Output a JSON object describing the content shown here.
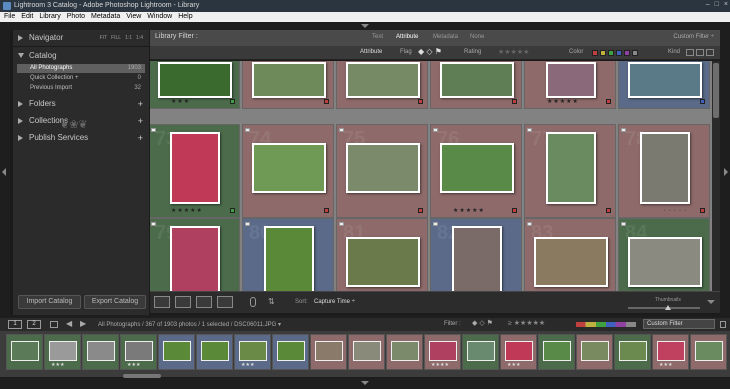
{
  "window": {
    "title": "Lightroom 3 Catalog - Adobe Photoshop Lightroom - Library",
    "controls": [
      "–",
      "□",
      "×"
    ]
  },
  "menu": [
    "File",
    "Edit",
    "Library",
    "Photo",
    "Metadata",
    "View",
    "Window",
    "Help"
  ],
  "left_panel": {
    "navigator": {
      "label": "Navigator",
      "options": [
        "FIT",
        "FILL",
        "1:1",
        "1:4"
      ]
    },
    "catalog": {
      "label": "Catalog",
      "items": [
        {
          "label": "All Photographs",
          "count": "1903"
        },
        {
          "label": "Quick Collection +",
          "count": "0"
        },
        {
          "label": "Previous Import",
          "count": "32"
        }
      ]
    },
    "folders": {
      "label": "Folders"
    },
    "collections": {
      "label": "Collections"
    },
    "publish": {
      "label": "Publish Services"
    },
    "ornament": "❦❀❦",
    "import_label": "Import Catalog",
    "export_label": "Export Catalog"
  },
  "filter_bar": {
    "title": "Library Filter :",
    "tabs": [
      "Text",
      "Attribute",
      "Metadata",
      "None"
    ],
    "selected_tab": "Attribute",
    "custom_filter": "Custom Filter ÷",
    "attr_label": "Attribute",
    "flag_label": "Flag",
    "rating_label": "Rating",
    "color_label": "Color",
    "kind_label": "Kind",
    "stars": "★★★★★",
    "swatch_colors": [
      "#c04040",
      "#c0b040",
      "#40a040",
      "#4060c0",
      "#9040a0",
      "#888888"
    ]
  },
  "grid": {
    "cells": [
      {
        "row": 0,
        "col": 0,
        "bg": "#4b6b4b",
        "photo": "#3a6a2e",
        "stars": "★★★",
        "badge": "#40a040"
      },
      {
        "row": 0,
        "col": 1,
        "bg": "#8e6a6a",
        "photo": "#6f8a5a",
        "badge": "#c04040"
      },
      {
        "row": 0,
        "col": 2,
        "bg": "#8e6a6a",
        "photo": "#768a66",
        "badge": "#c04040"
      },
      {
        "row": 0,
        "col": 3,
        "bg": "#8e6a6a",
        "photo": "#5f7e55",
        "badge": "#c04040"
      },
      {
        "row": 0,
        "col": 4,
        "bg": "#8e6a6a",
        "photo": "#8a6a7a",
        "stars": "★★★★★",
        "badge": "#c04040"
      },
      {
        "row": 0,
        "col": 5,
        "bg": "#5a6a88",
        "photo": "#5a7a88",
        "badge": "#4060c0"
      },
      {
        "row": 1,
        "col": 0,
        "bg": "#4b6b4b",
        "num": "73",
        "photo": "#c03a58",
        "stars": "★★★★★",
        "badge": "#40a040"
      },
      {
        "row": 1,
        "col": 1,
        "bg": "#8e6a6a",
        "num": "74",
        "photo": "#6f9a55",
        "badge": "#c04040"
      },
      {
        "row": 1,
        "col": 2,
        "bg": "#8e6a6a",
        "num": "75",
        "photo": "#7a8a6a",
        "badge": "#c04040"
      },
      {
        "row": 1,
        "col": 3,
        "bg": "#8e6a6a",
        "num": "76",
        "photo": "#5a8a48",
        "stars": "★★★★★",
        "badge": "#c04040"
      },
      {
        "row": 1,
        "col": 4,
        "bg": "#8e6a6a",
        "num": "77",
        "photo": "#6a8a60",
        "badge": "#c04040"
      },
      {
        "row": 1,
        "col": 5,
        "bg": "#8e6a6a",
        "num": "78",
        "photo": "#7a7a70",
        "dots": "• • • • •",
        "badge": "#c04040"
      },
      {
        "row": 2,
        "col": 0,
        "bg": "#4b6b4b",
        "num": "79",
        "photo": "#b04060"
      },
      {
        "row": 2,
        "col": 1,
        "bg": "#5a6a88",
        "num": "80",
        "photo": "#5a8a38"
      },
      {
        "row": 2,
        "col": 2,
        "bg": "#8e6a6a",
        "num": "81",
        "photo": "#6a7a4a"
      },
      {
        "row": 2,
        "col": 3,
        "bg": "#5a6a88",
        "num": "82",
        "photo": "#7a6a68"
      },
      {
        "row": 2,
        "col": 4,
        "bg": "#8e6a6a",
        "num": "83",
        "photo": "#8a7a60"
      },
      {
        "row": 2,
        "col": 5,
        "bg": "#4b6b4b",
        "num": "84",
        "photo": "#8a8a80"
      }
    ]
  },
  "toolbar": {
    "sort_label": "Sort:",
    "sort_value": "Capture Time ÷",
    "thumbnails_label": "Thumbnails"
  },
  "filmstrip_bar": {
    "screens": [
      "1",
      "2"
    ],
    "path": "All Photographs / 367 of 1903 photos / 1 selected / DSC06011.JPG ▾",
    "filter_label": "Filter :",
    "custom_filter": "Custom Filter"
  },
  "filmstrip": [
    {
      "bg": "#4b6b4b",
      "photo": "#5a7a58"
    },
    {
      "bg": "#4b6b4b",
      "photo": "#9a9a9a",
      "stars": "★★★"
    },
    {
      "bg": "#4b6b4b",
      "photo": "#8a8a8a"
    },
    {
      "bg": "#4b6b4b",
      "photo": "#7a7a7a",
      "stars": "★★★"
    },
    {
      "bg": "#5a6a88",
      "photo": "#5a8a38"
    },
    {
      "bg": "#5a6a88",
      "photo": "#5a8a38"
    },
    {
      "bg": "#5a6a88",
      "photo": "#6a8a48",
      "stars": "★★★"
    },
    {
      "bg": "#5a6a88",
      "photo": "#5a8a38"
    },
    {
      "bg": "#8e6a6a",
      "photo": "#8a7a6a"
    },
    {
      "bg": "#8e6a6a",
      "photo": "#8a8a7a"
    },
    {
      "bg": "#8e6a6a",
      "photo": "#7a8a6a"
    },
    {
      "bg": "#8e6a6a",
      "photo": "#b04060",
      "stars": "★★★★"
    },
    {
      "bg": "#4b6b4b",
      "photo": "#6a8a70"
    },
    {
      "bg": "#8e6a6a",
      "photo": "#c03a58",
      "stars": "★★★"
    },
    {
      "bg": "#4b6b4b",
      "photo": "#5a8a48"
    },
    {
      "bg": "#8e6a6a",
      "photo": "#7a8a60"
    },
    {
      "bg": "#4b6b4b",
      "photo": "#6a8a50"
    },
    {
      "bg": "#8e6a6a",
      "photo": "#c04060",
      "stars": "★★★"
    },
    {
      "bg": "#8e6a6a",
      "photo": "#6a8a60"
    }
  ]
}
